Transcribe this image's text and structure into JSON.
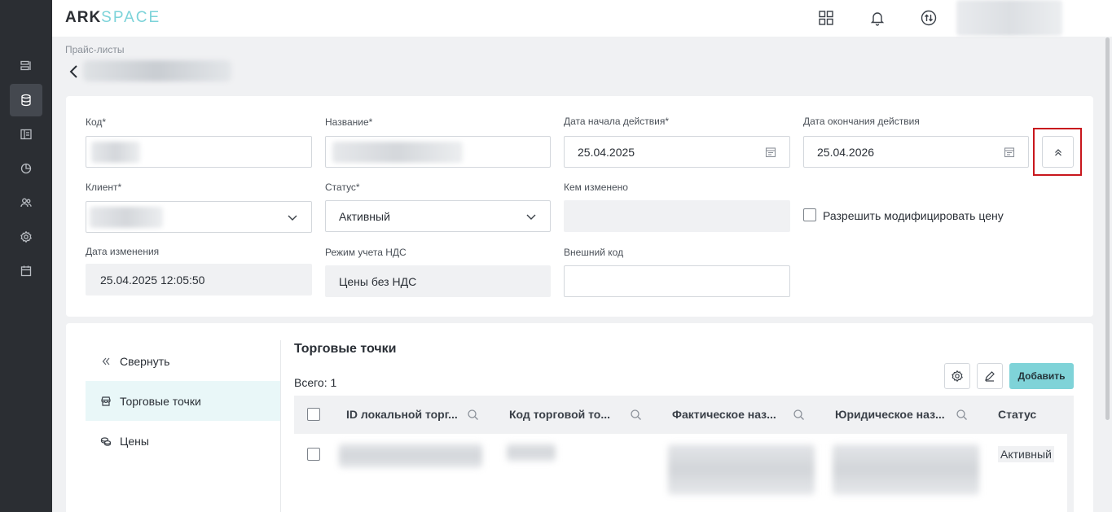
{
  "app": {
    "logo_part1": "ARK",
    "logo_part2": "SPACE"
  },
  "breadcrumb": "Прайс-листы",
  "form": {
    "code": {
      "label": "Код*"
    },
    "name": {
      "label": "Название*"
    },
    "start_date": {
      "label": "Дата начала действия*",
      "value": "25.04.2025"
    },
    "end_date": {
      "label": "Дата окончания действия",
      "value": "25.04.2026"
    },
    "client": {
      "label": "Клиент*"
    },
    "status": {
      "label": "Статус*",
      "value": "Активный"
    },
    "modified_by": {
      "label": "Кем изменено",
      "value": ""
    },
    "allow_modify_price": {
      "label": "Разрешить модифицировать цену",
      "checked": false
    },
    "modified_date": {
      "label": "Дата изменения",
      "value": "25.04.2025 12:05:50"
    },
    "vat_mode": {
      "label": "Режим учета НДС",
      "value": "Цены без НДС"
    },
    "external_code": {
      "label": "Внешний код",
      "value": ""
    }
  },
  "side_nav": {
    "collapse_label": "Свернуть",
    "items": [
      {
        "label": "Торговые точки",
        "active": true
      },
      {
        "label": "Цены",
        "active": false
      }
    ]
  },
  "outlets": {
    "title": "Торговые точки",
    "total_label": "Всего: 1",
    "add_button": "Добавить",
    "columns": [
      {
        "label": "ID локальной торг..."
      },
      {
        "label": "Код торговой то..."
      },
      {
        "label": "Фактическое наз..."
      },
      {
        "label": "Юридическое наз..."
      },
      {
        "label": "Статус"
      }
    ],
    "rows": [
      {
        "status": "Активный"
      }
    ]
  },
  "colors": {
    "accent": "#7fd3d8",
    "rail": "#2b2e33",
    "highlight_frame": "#c8171d"
  },
  "icons": {
    "rail": [
      "list-icon",
      "database-icon",
      "layout-icon",
      "pie-chart-icon",
      "users-icon",
      "gear-icon",
      "calendar-icon"
    ],
    "header": [
      "apps-grid-icon",
      "bell-icon",
      "sync-icon"
    ]
  }
}
